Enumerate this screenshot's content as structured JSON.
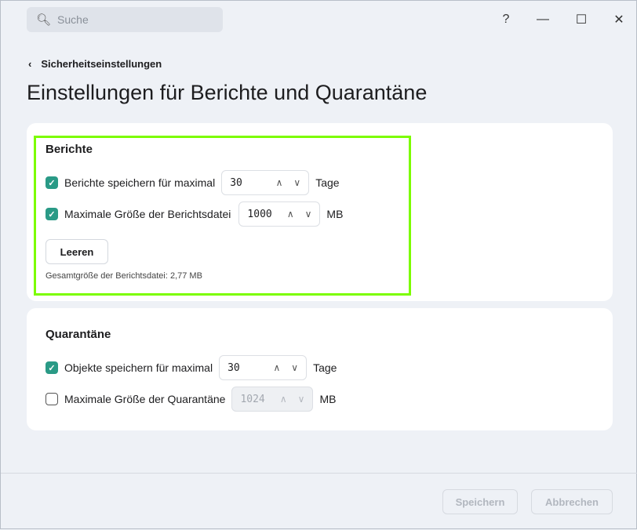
{
  "header": {
    "search_placeholder": "Suche",
    "help": "?",
    "minimize": "—",
    "maximize": "☐",
    "close": "✕"
  },
  "breadcrumb": {
    "back_label": "Sicherheitseinstellungen"
  },
  "page_title": "Einstellungen für Berichte und Quarantäne",
  "reports": {
    "heading": "Berichte",
    "keep": {
      "checked": true,
      "label": "Berichte speichern für maximal",
      "value": "30",
      "unit": "Tage"
    },
    "max_size": {
      "checked": true,
      "label": "Maximale Größe der Berichtsdatei",
      "value": "1000",
      "unit": "MB"
    },
    "clear_button": "Leeren",
    "total_size": "Gesamtgröße der Berichtsdatei: 2,77 MB"
  },
  "quarantine": {
    "heading": "Quarantäne",
    "keep": {
      "checked": true,
      "label": "Objekte speichern für maximal",
      "value": "30",
      "unit": "Tage"
    },
    "max_size": {
      "checked": false,
      "label": "Maximale Größe der Quarantäne",
      "value": "1024",
      "unit": "MB",
      "disabled": true
    }
  },
  "footer": {
    "save": "Speichern",
    "cancel": "Abbrechen"
  },
  "colors": {
    "accent": "#2a9a86",
    "highlight": "#7cfc00"
  }
}
